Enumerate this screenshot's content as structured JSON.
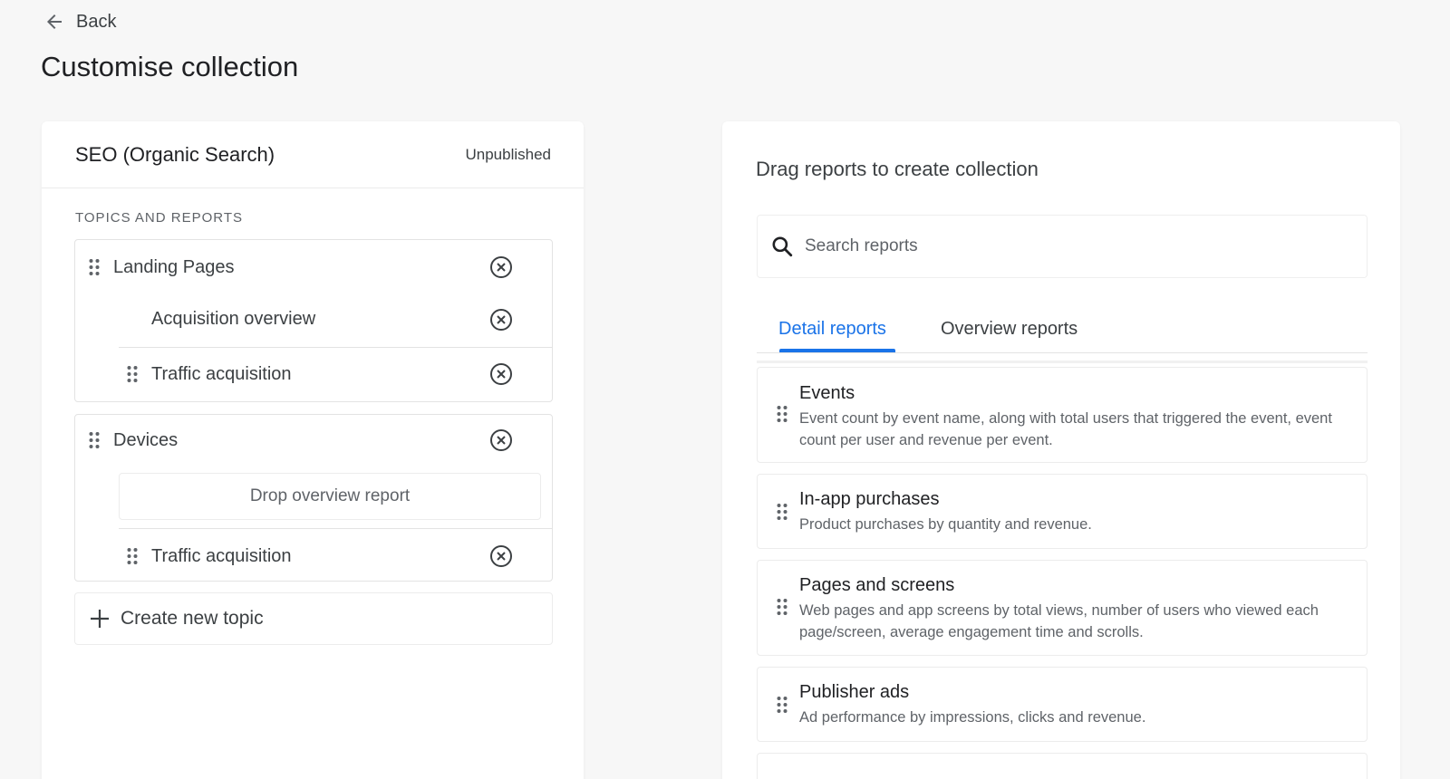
{
  "header": {
    "back_label": "Back",
    "page_title": "Customise collection"
  },
  "collection": {
    "name": "SEO (Organic Search)",
    "status": "Unpublished",
    "section_label": "TOPICS AND REPORTS",
    "topics": [
      {
        "name": "Landing Pages",
        "overview": "Acquisition overview",
        "reports": [
          "Traffic acquisition"
        ]
      },
      {
        "name": "Devices",
        "overview_placeholder": "Drop overview report",
        "reports": [
          "Traffic acquisition"
        ]
      }
    ],
    "create_topic_label": "Create new topic"
  },
  "library": {
    "title": "Drag reports to create collection",
    "search_placeholder": "Search reports",
    "tabs": [
      {
        "label": "Detail reports",
        "active": true
      },
      {
        "label": "Overview reports",
        "active": false
      }
    ],
    "reports": [
      {
        "title": "Events",
        "description": "Event count by event name, along with total users that triggered the event, event count per user and revenue per event."
      },
      {
        "title": "In-app purchases",
        "description": "Product purchases by quantity and revenue."
      },
      {
        "title": "Pages and screens",
        "description": "Web pages and app screens by total views, number of users who viewed each page/screen, average engagement time and scrolls."
      },
      {
        "title": "Publisher ads",
        "description": "Ad performance by impressions, clicks and revenue."
      }
    ]
  },
  "colors": {
    "accent": "#1a73e8",
    "text": "#3c4043",
    "background": "#f7f7f7"
  },
  "icons": {
    "back": "arrow-left-icon",
    "drag": "drag-handle-icon",
    "remove": "close-circle-icon",
    "add": "plus-icon",
    "search": "search-icon"
  }
}
